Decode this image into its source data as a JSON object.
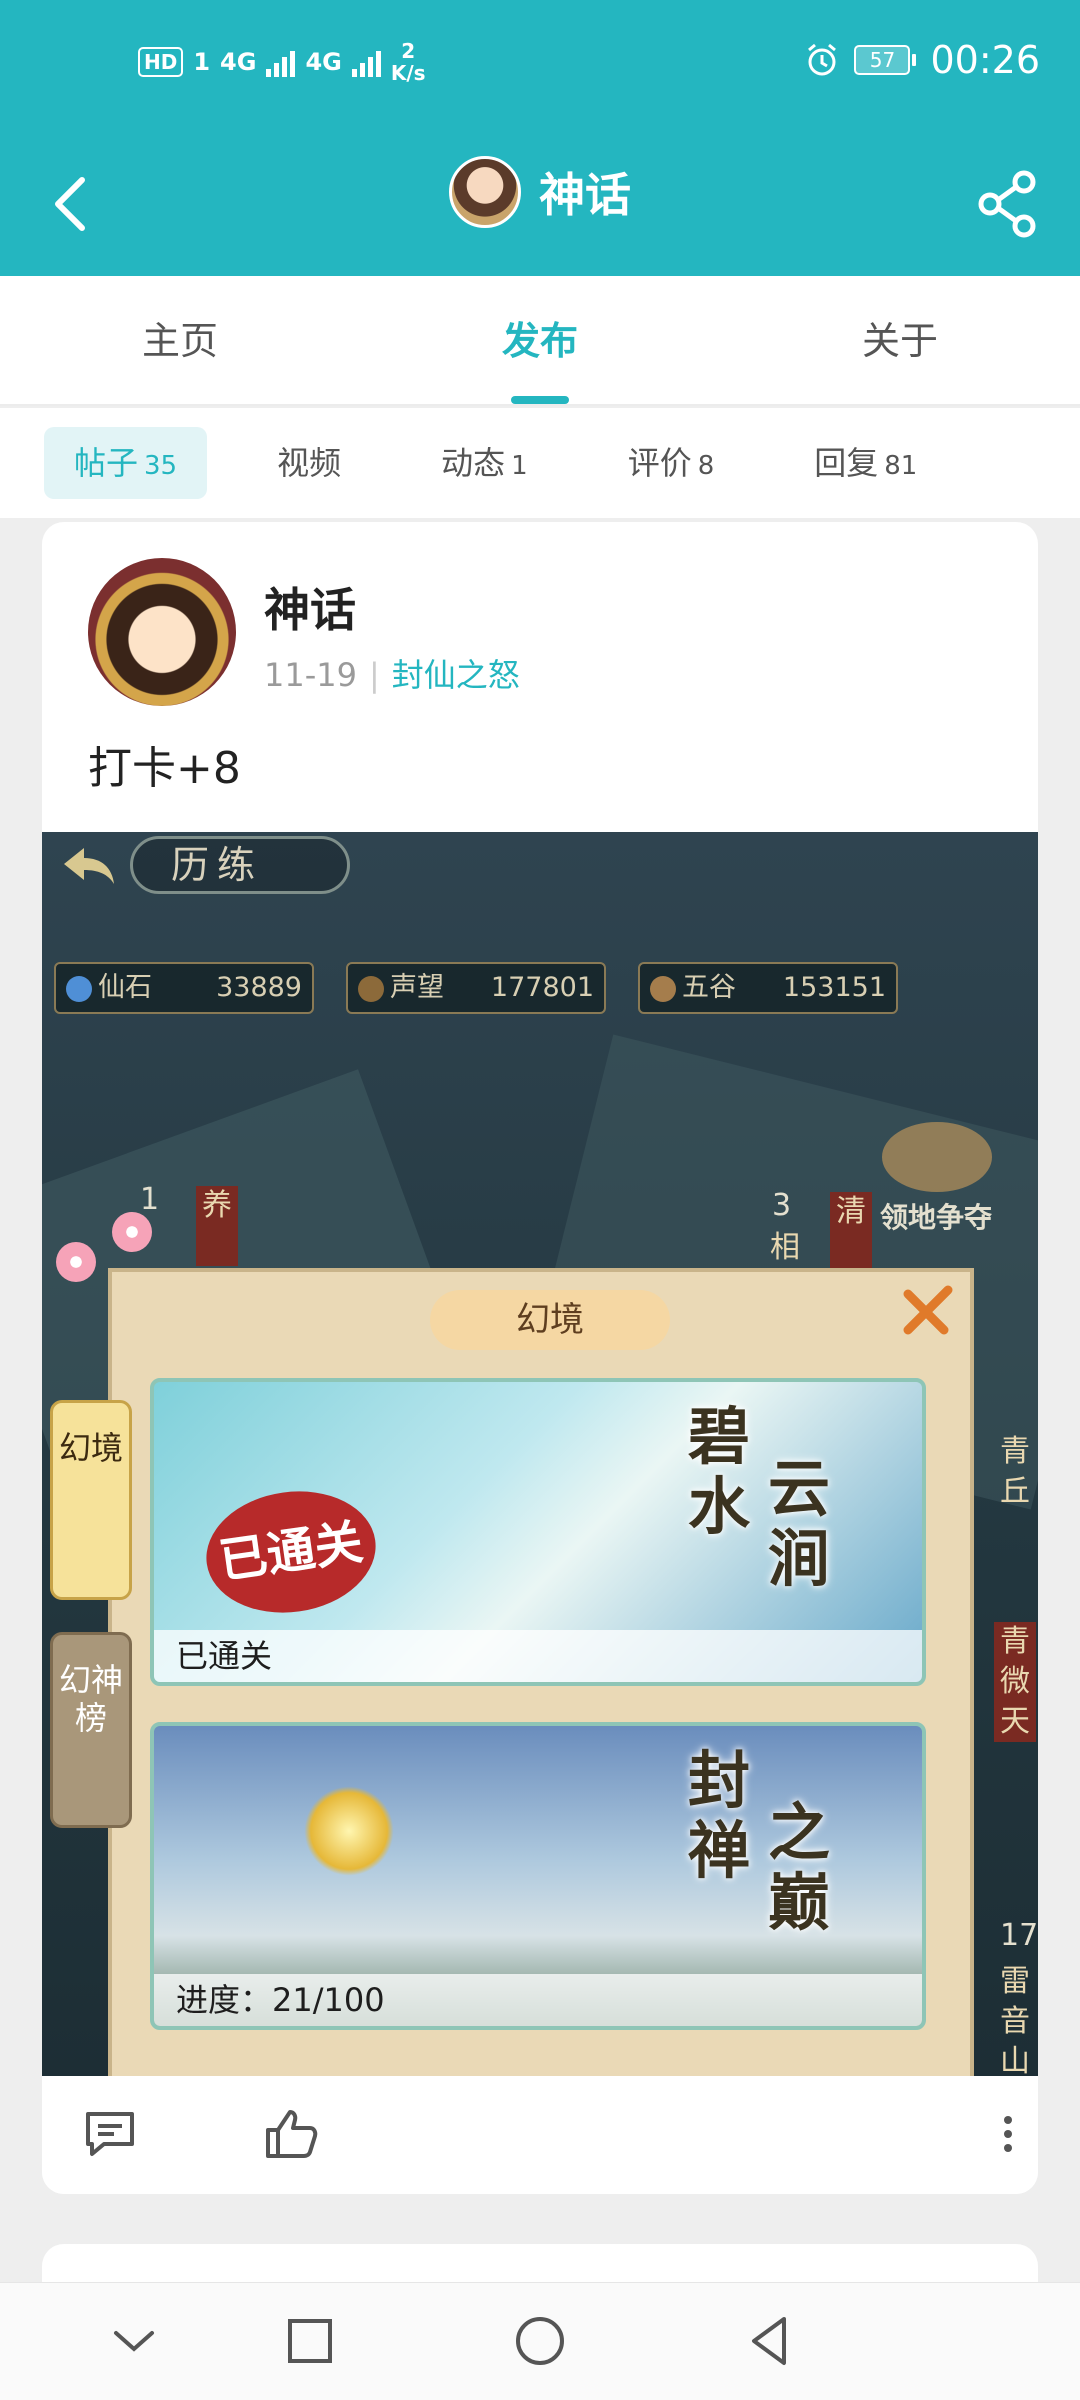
{
  "status_bar": {
    "hd_label": "HD",
    "sim1": "1",
    "net1": "4G",
    "net2": "4G",
    "speed_value": "2",
    "speed_unit": "K/s",
    "battery": "57",
    "time": "00:26"
  },
  "app_bar": {
    "title": "神话"
  },
  "tabs": [
    {
      "label": "主页",
      "active": false
    },
    {
      "label": "发布",
      "active": true
    },
    {
      "label": "关于",
      "active": false
    }
  ],
  "subtabs": [
    {
      "label": "帖子",
      "count": "35",
      "active": true
    },
    {
      "label": "视频",
      "count": "",
      "active": false
    },
    {
      "label": "动态",
      "count": "1",
      "active": false
    },
    {
      "label": "评价",
      "count": "8",
      "active": false
    },
    {
      "label": "回复",
      "count": "81",
      "active": false
    }
  ],
  "post": {
    "author": "神话",
    "date": "11-19",
    "game": "封仙之怒",
    "text": "打卡+8",
    "image": {
      "header": "历练",
      "resources": [
        {
          "name": "仙石",
          "value": "33889",
          "color": "#4f8fd6"
        },
        {
          "name": "声望",
          "value": "177801",
          "color": "#8c6a3a"
        },
        {
          "name": "五谷",
          "value": "153151",
          "color": "#a57d4c"
        }
      ],
      "map_labels": {
        "num1": "1",
        "ribbon1": "养",
        "num3": "3",
        "ribbon_a": "相",
        "ribbon_b": "清",
        "territory": "领地争夺",
        "right_ribbon1": "青丘",
        "right_ribbon2": "青微天",
        "num17": "17",
        "right_ribbon3": "雷音山"
      },
      "panel_title": "幻境",
      "side_tabs": [
        "幻境",
        "幻神榜"
      ],
      "stages": [
        {
          "name": [
            "碧",
            "水",
            "云",
            "涧"
          ],
          "status": "已通关",
          "stamp": "已通关"
        },
        {
          "name": [
            "封",
            "禅",
            "之",
            "巅"
          ],
          "status": "进度：21/100",
          "stamp": ""
        }
      ]
    }
  }
}
